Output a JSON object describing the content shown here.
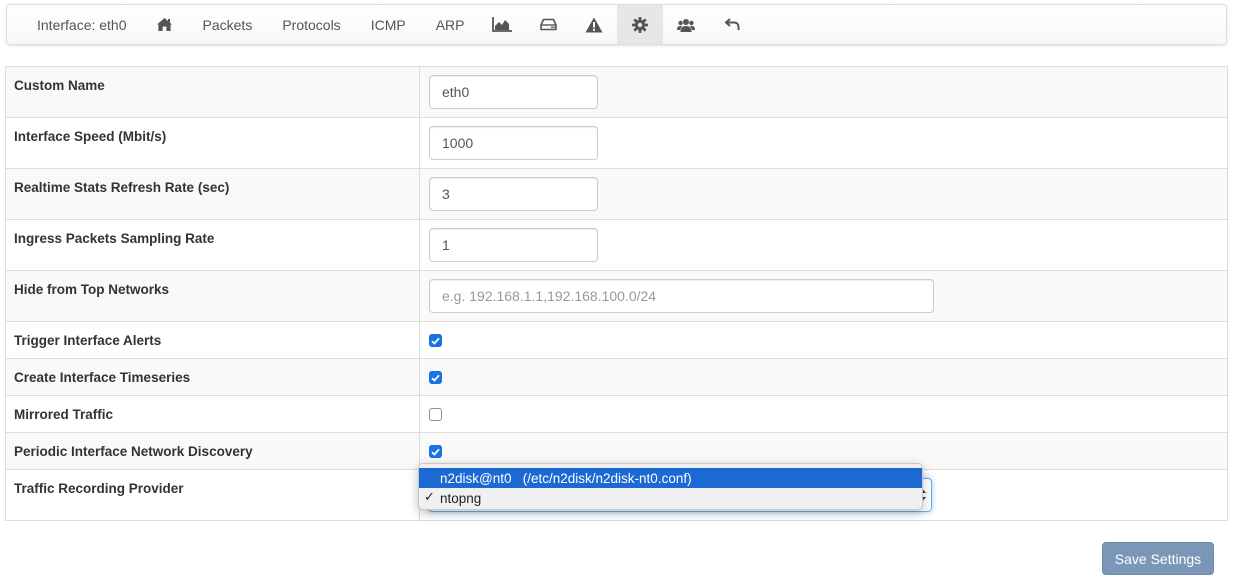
{
  "colors": {
    "accent": "#1a73e8",
    "dropdown_highlight": "#1c69d4",
    "save_button": "#7a97b7"
  },
  "nav": {
    "interface_label": "Interface: eth0",
    "items": [
      {
        "type": "icon",
        "icon": "home-icon"
      },
      {
        "type": "text",
        "label": "Packets"
      },
      {
        "type": "text",
        "label": "Protocols"
      },
      {
        "type": "text",
        "label": "ICMP"
      },
      {
        "type": "text",
        "label": "ARP"
      },
      {
        "type": "icon",
        "icon": "area-chart-icon"
      },
      {
        "type": "icon",
        "icon": "hard-drive-icon"
      },
      {
        "type": "icon",
        "icon": "warning-icon"
      },
      {
        "type": "icon",
        "icon": "gear-icon",
        "active": true
      },
      {
        "type": "icon",
        "icon": "users-icon"
      },
      {
        "type": "icon",
        "icon": "undo-icon"
      }
    ]
  },
  "settings": {
    "custom_name": {
      "label": "Custom Name",
      "value": "eth0"
    },
    "interface_speed": {
      "label": "Interface Speed (Mbit/s)",
      "value": "1000"
    },
    "refresh_rate": {
      "label": "Realtime Stats Refresh Rate (sec)",
      "value": "3"
    },
    "sampling_rate": {
      "label": "Ingress Packets Sampling Rate",
      "value": "1"
    },
    "hide_networks": {
      "label": "Hide from Top Networks",
      "value": "",
      "placeholder": "e.g. 192.168.1.1,192.168.100.0/24"
    },
    "trigger_alerts": {
      "label": "Trigger Interface Alerts",
      "checked": true
    },
    "create_timeseries": {
      "label": "Create Interface Timeseries",
      "checked": true
    },
    "mirrored_traffic": {
      "label": "Mirrored Traffic",
      "checked": false
    },
    "network_discovery": {
      "label": "Periodic Interface Network Discovery",
      "checked": true
    },
    "recording_provider": {
      "label": "Traffic Recording Provider",
      "selected": "ntopng",
      "options": [
        {
          "label": "n2disk@nt0   (/etc/n2disk/n2disk-nt0.conf)",
          "highlighted": true
        },
        {
          "label": "ntopng",
          "checked": true
        }
      ]
    }
  },
  "save_button": {
    "label": "Save Settings"
  }
}
